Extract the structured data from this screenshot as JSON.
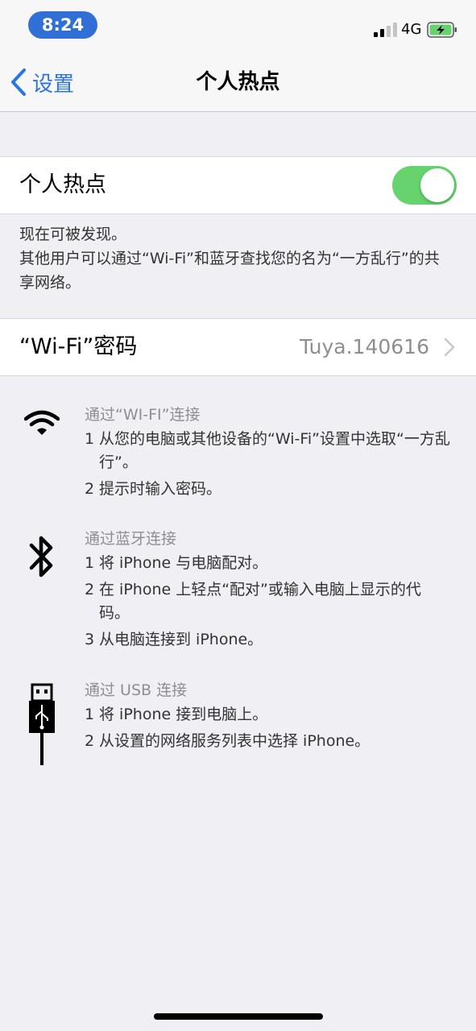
{
  "status_bar": {
    "time": "8:24",
    "network": "4G",
    "signal_icon": "cell-signal-icon",
    "battery_icon": "battery-charging-icon",
    "accent_color": "#2f6fd6",
    "battery_color": "#66d36e"
  },
  "nav": {
    "back_label": "设置",
    "title": "个人热点",
    "back_icon": "chevron-left-icon",
    "tint_color": "#2a74e4"
  },
  "hotspot": {
    "label": "个人热点",
    "toggle_on": true,
    "toggle_color": "#66d36e"
  },
  "discoverable_note": {
    "line1": "现在可被发现。",
    "line2": "其他用户可以通过“Wi-Fi”和蓝牙查找您的名为“一方乱行”的共享网络。"
  },
  "wifi_password": {
    "label": "“Wi-Fi”密码",
    "value": "Tuya.140616",
    "chevron_icon": "chevron-right-icon"
  },
  "methods": [
    {
      "icon": "wifi-icon",
      "heading": "通过“WI-FI”连接",
      "steps": [
        {
          "num": "1",
          "text": "从您的电脑或其他设备的“Wi-Fi”设置中选取“一方乱行”。"
        },
        {
          "num": "2",
          "text": "提示时输入密码。"
        }
      ]
    },
    {
      "icon": "bluetooth-icon",
      "heading": "通过蓝牙连接",
      "steps": [
        {
          "num": "1",
          "text": "将 iPhone 与电脑配对。"
        },
        {
          "num": "2",
          "text": "在 iPhone 上轻点“配对”或输入电脑上显示的代码。"
        },
        {
          "num": "3",
          "text": "从电脑连接到 iPhone。"
        }
      ]
    },
    {
      "icon": "usb-cable-icon",
      "heading": "通过 USB 连接",
      "steps": [
        {
          "num": "1",
          "text": "将 iPhone 接到电脑上。"
        },
        {
          "num": "2",
          "text": "从设置的网络服务列表中选择 iPhone。"
        }
      ]
    }
  ]
}
